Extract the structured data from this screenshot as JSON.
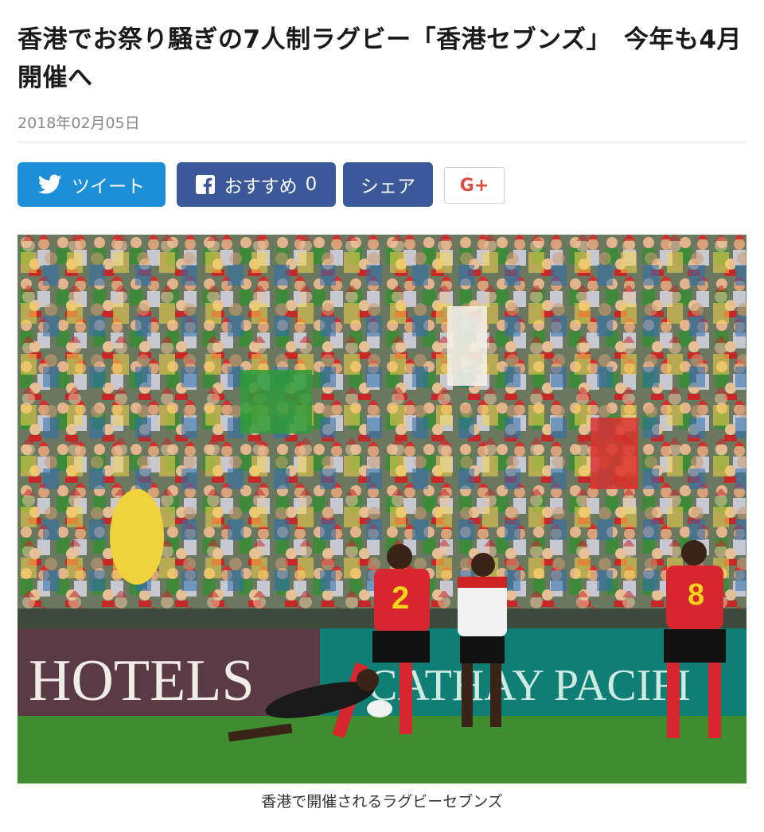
{
  "article": {
    "title": "香港でお祭り騒ぎの7人制ラグビー「香港セブンズ」　今年も4月開催へ",
    "date": "2018年02月05日"
  },
  "share": {
    "tweet_label": "ツイート",
    "like_label": "おすすめ",
    "like_count": "0",
    "share_label": "シェア",
    "gplus_label": "G+"
  },
  "photo": {
    "caption": "香港で開催されるラグビーセブンズ",
    "banner_left": "HOTELS",
    "banner_right": "CATHAY PACIFI",
    "jersey_numbers": [
      "2",
      "8"
    ]
  },
  "colors": {
    "twitter": "#1d8fd9",
    "facebook": "#3b5998",
    "gplus": "#dc4e41"
  },
  "icons": [
    "twitter-bird-icon",
    "facebook-icon",
    "google-plus-icon"
  ]
}
